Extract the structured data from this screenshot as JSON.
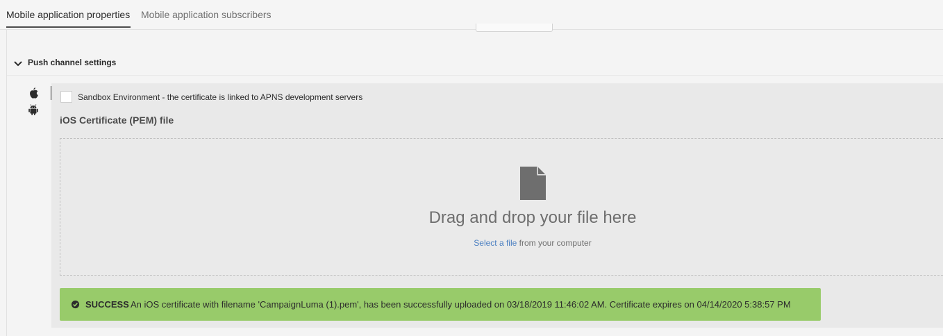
{
  "tabs": [
    {
      "label": "Mobile application properties",
      "active": true
    },
    {
      "label": "Mobile application subscribers",
      "active": false
    }
  ],
  "section": {
    "title": "Push channel settings",
    "expanded": true
  },
  "platforms": [
    {
      "icon": "apple-icon",
      "selected": true
    },
    {
      "icon": "android-icon",
      "selected": false
    }
  ],
  "sandbox": {
    "checked": false,
    "label": "Sandbox Environment - the certificate is linked to APNS development servers"
  },
  "certificate": {
    "title": "iOS Certificate (PEM) file"
  },
  "dropzone": {
    "icon": "file-icon",
    "heading": "Drag and drop your file here",
    "link_text": "Select a file",
    "suffix": " from your computer"
  },
  "status": {
    "icon": "check-circle-icon",
    "label": "SUCCESS",
    "message": "An iOS certificate with filename 'CampaignLuma (1).pem', has been successfully uploaded on 03/18/2019 11:46:02 AM. Certificate expires on 04/14/2020 5:38:57 PM",
    "color": "#98cb6a"
  },
  "colors": {
    "link": "#4a7fc1",
    "success_bg": "#98cb6a",
    "panel_bg": "#e9e9e9"
  }
}
